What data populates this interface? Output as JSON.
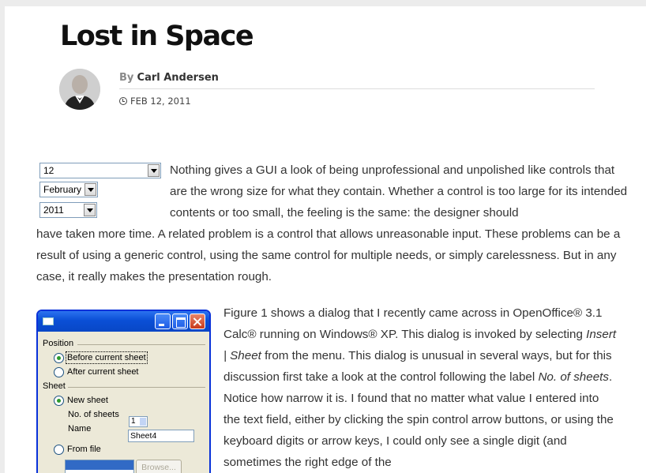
{
  "article": {
    "title": "Lost in Space",
    "by_prefix": "By",
    "author": "Carl Andersen",
    "date": "FEB 12, 2011",
    "icons": {
      "date": "clock-icon",
      "avatar": "author-avatar"
    }
  },
  "combos": {
    "day": "12",
    "month": "February",
    "year": "2011"
  },
  "paragraphs": {
    "p1a": "Nothing gives a GUI a look of being unprofessional and unpolished like controls that are the wrong size for what they contain. Whether a control is too large for its intended contents or too small, the feeling is the same: the designer should",
    "p1b": "have taken more time. A related problem is a control that allows unreasonable input. These problems can be a result of using a generic control, using the same control for multiple needs, or simply carelessness. But in any case, it really makes the presentation rough.",
    "p2_start": "Figure 1 shows a dialog that I recently came across in OpenOffice® 3.1 Calc® running on Windows® XP. This dialog is invoked by selecting ",
    "p2_menu": "Insert | Sheet",
    "p2_mid": " from the menu. This dialog is unusual in several ways, but for this discussion first take a look at the control following the label ",
    "p2_label": "No. of sheets",
    "p2_end": ". Notice how narrow it is. I found that no matter what value I entered into the text field, either by clicking the spin control arrow buttons, or using the keyboard digits or arrow keys, I could only see a single digit (and sometimes the right edge of the"
  },
  "dialog": {
    "position_label": "Position",
    "before_sheet": "Before current sheet",
    "after_sheet": "After current sheet",
    "sheet_label": "Sheet",
    "new_sheet": "New sheet",
    "no_of_sheets": "No. of sheets",
    "no_of_sheets_value": "1",
    "name_label": "Name",
    "name_value": "Sheet4",
    "from_file": "From file",
    "browse": "Browse..."
  }
}
